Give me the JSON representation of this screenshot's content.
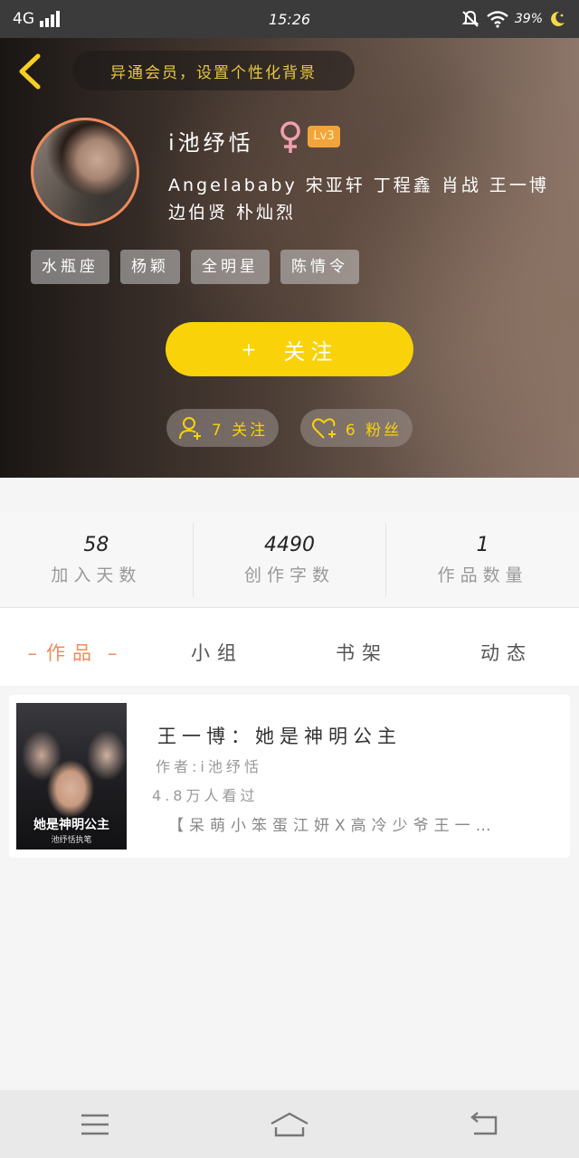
{
  "status_bar": {
    "network": "4G",
    "time": "15:26",
    "battery": "39%"
  },
  "header": {
    "bg_tip": "异通会员，设置个性化背景",
    "username": "i池纾恬",
    "level": "Lv3",
    "favorite_stars": "Angelababy 宋亚轩 丁程鑫 肖战 王一博 边伯贤 朴灿烈",
    "tags": [
      "水瓶座",
      "杨颖",
      "全明星",
      "陈情令"
    ],
    "follow_button": "关注",
    "follow_plus": "+",
    "following": "7 关注",
    "fans": "6 粉丝"
  },
  "stats": [
    {
      "value": "58",
      "label": "加入天数"
    },
    {
      "value": "4490",
      "label": "创作字数"
    },
    {
      "value": "1",
      "label": "作品数量"
    }
  ],
  "tabs": [
    {
      "label": "作品",
      "active": true
    },
    {
      "label": "小组",
      "active": false
    },
    {
      "label": "书架",
      "active": false
    },
    {
      "label": "动态",
      "active": false
    }
  ],
  "works": [
    {
      "title": "王一博：她是神明公主",
      "author": "作者:i池纾恬",
      "views": "4.8万人看过",
      "description": "【呆萌小笨蛋江妍X高冷少爷王一…",
      "cover_title": "她是神明公主",
      "cover_subtitle": "池纾恬执笔"
    }
  ],
  "colors": {
    "accent_yellow": "#f9d20a",
    "accent_orange": "#f08a5a",
    "level_badge": "#f2a43a",
    "gender_pink": "#f0a0b0"
  },
  "icons": [
    "back-icon",
    "female-icon",
    "add-user-icon",
    "heart-plus-icon",
    "menu-icon",
    "home-icon",
    "return-icon"
  ]
}
